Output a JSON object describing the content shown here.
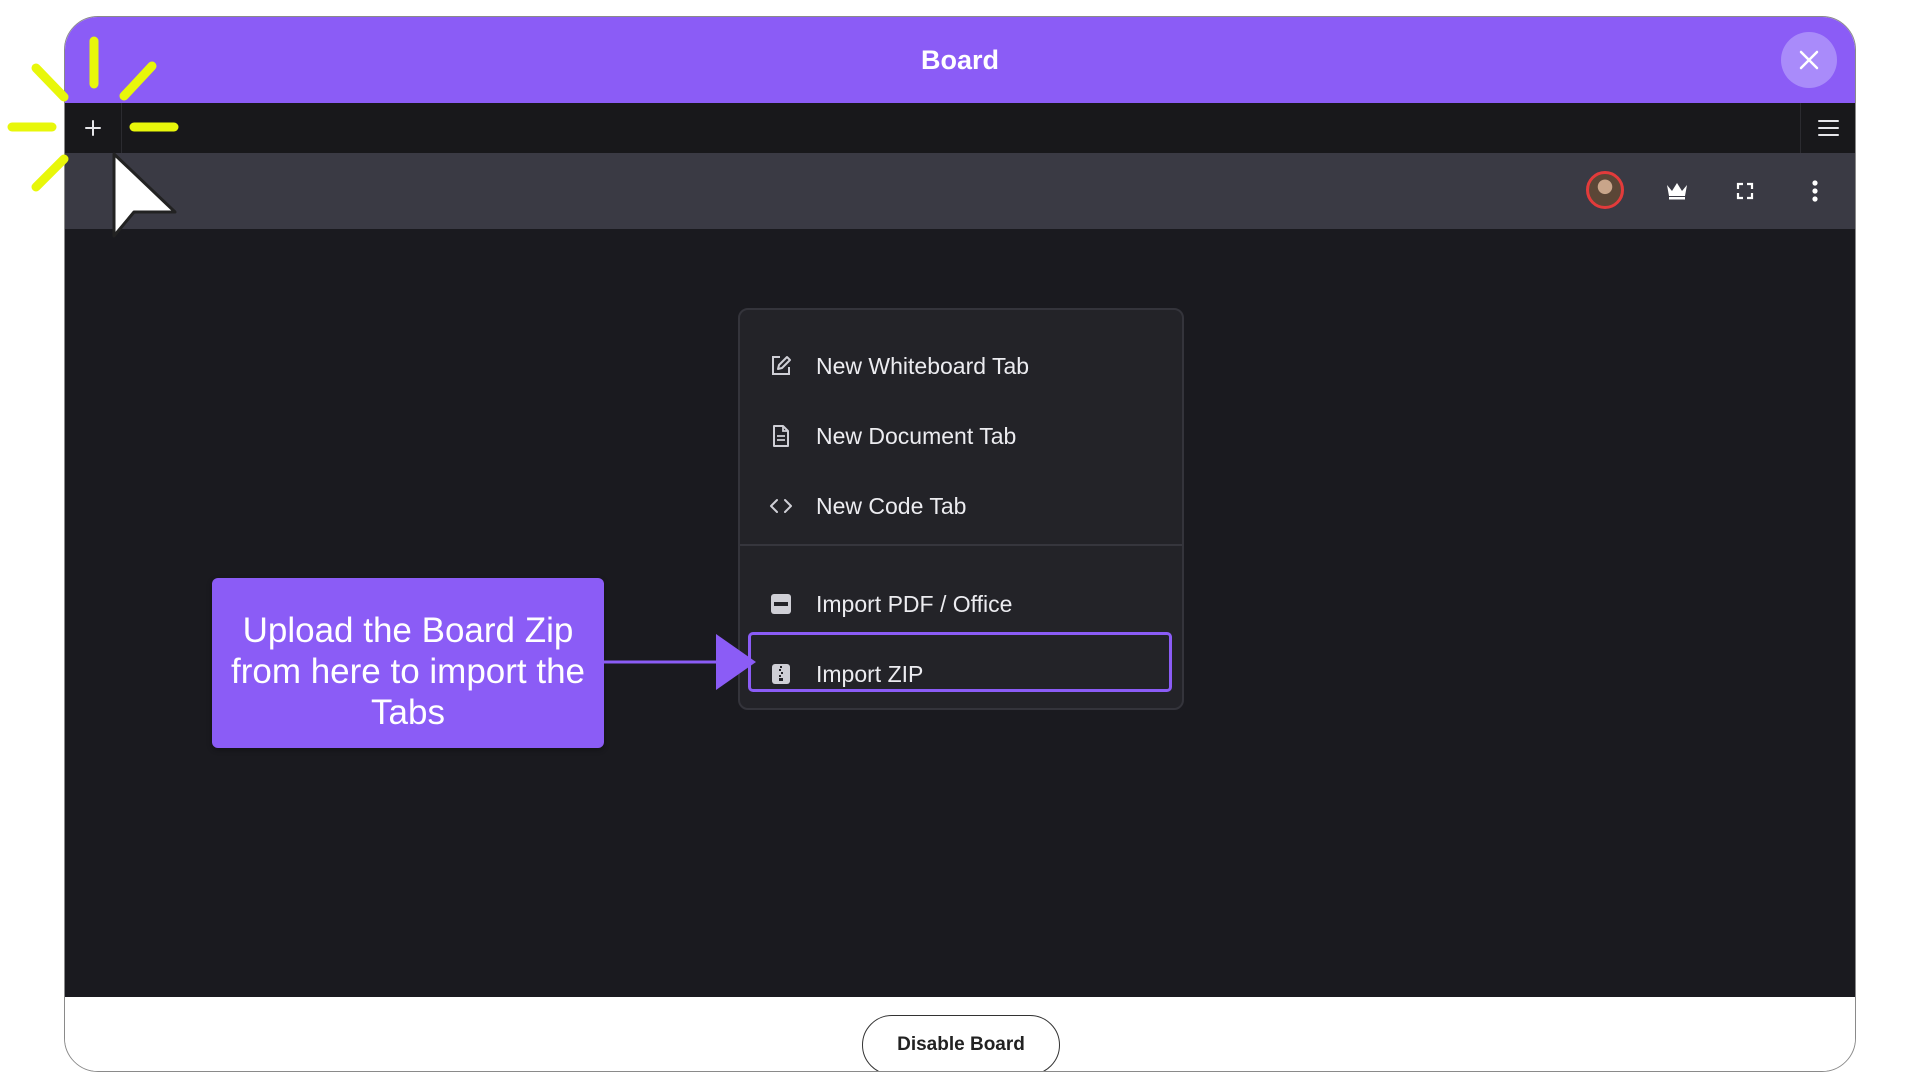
{
  "window": {
    "title": "Board"
  },
  "dropdown": {
    "items": [
      {
        "label": "New Whiteboard Tab",
        "icon": "edit-icon"
      },
      {
        "label": "New Document Tab",
        "icon": "document-icon"
      },
      {
        "label": "New Code Tab",
        "icon": "code-icon"
      },
      {
        "label": "Import PDF / Office",
        "icon": "pdf-icon"
      },
      {
        "label": "Import ZIP",
        "icon": "zip-icon"
      }
    ],
    "highlighted": "Import ZIP"
  },
  "callout": {
    "text": "Upload the Board Zip from here to import the Tabs"
  },
  "footer": {
    "disable_label": "Disable Board"
  },
  "colors": {
    "accent": "#8b5cf6",
    "canvas": "#1a1a1f",
    "toolbar": "#3a3a44",
    "highlight_rays": "#e8f70a"
  }
}
